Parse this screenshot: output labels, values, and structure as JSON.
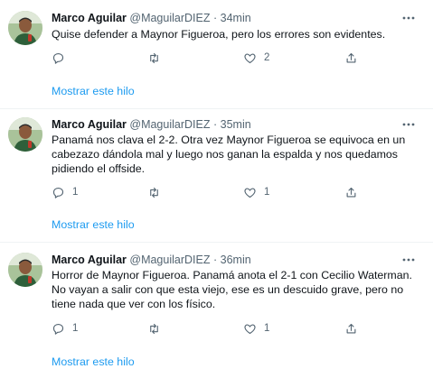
{
  "tweets": [
    {
      "name": "Marco Aguilar",
      "handle": "@MaguilarDIEZ",
      "dot": "·",
      "time": "34min",
      "text": "Quise defender a Maynor Figueroa, pero los errores son evidentes.",
      "reply_count": "",
      "retweet_count": "",
      "like_count": "2",
      "show_thread": "Mostrar este hilo"
    },
    {
      "name": "Marco Aguilar",
      "handle": "@MaguilarDIEZ",
      "dot": "·",
      "time": "35min",
      "text": "Panamá nos clava el 2-2. Otra vez Maynor Figueroa se equivoca en un cabezazo dándola mal y luego nos ganan la espalda y nos quedamos pidiendo el offside.",
      "reply_count": "1",
      "retweet_count": "",
      "like_count": "1",
      "show_thread": "Mostrar este hilo"
    },
    {
      "name": "Marco Aguilar",
      "handle": "@MaguilarDIEZ",
      "dot": "·",
      "time": "36min",
      "text": "Horror de Maynor Figueroa. Panamá anota el 2-1 con Cecilio Waterman. No vayan a salir con que esta viejo, ese es un descuido grave, pero no tiene nada que ver con los físico.",
      "reply_count": "1",
      "retweet_count": "",
      "like_count": "1",
      "show_thread": "Mostrar este hilo"
    }
  ],
  "icons": {
    "more": "more-horizontal-icon",
    "reply": "reply-icon",
    "retweet": "retweet-icon",
    "like": "heart-icon",
    "share": "share-icon"
  },
  "colors": {
    "link": "#1d9bf0",
    "muted": "#536471",
    "text": "#0f1419",
    "separator": "#eff3f4"
  }
}
